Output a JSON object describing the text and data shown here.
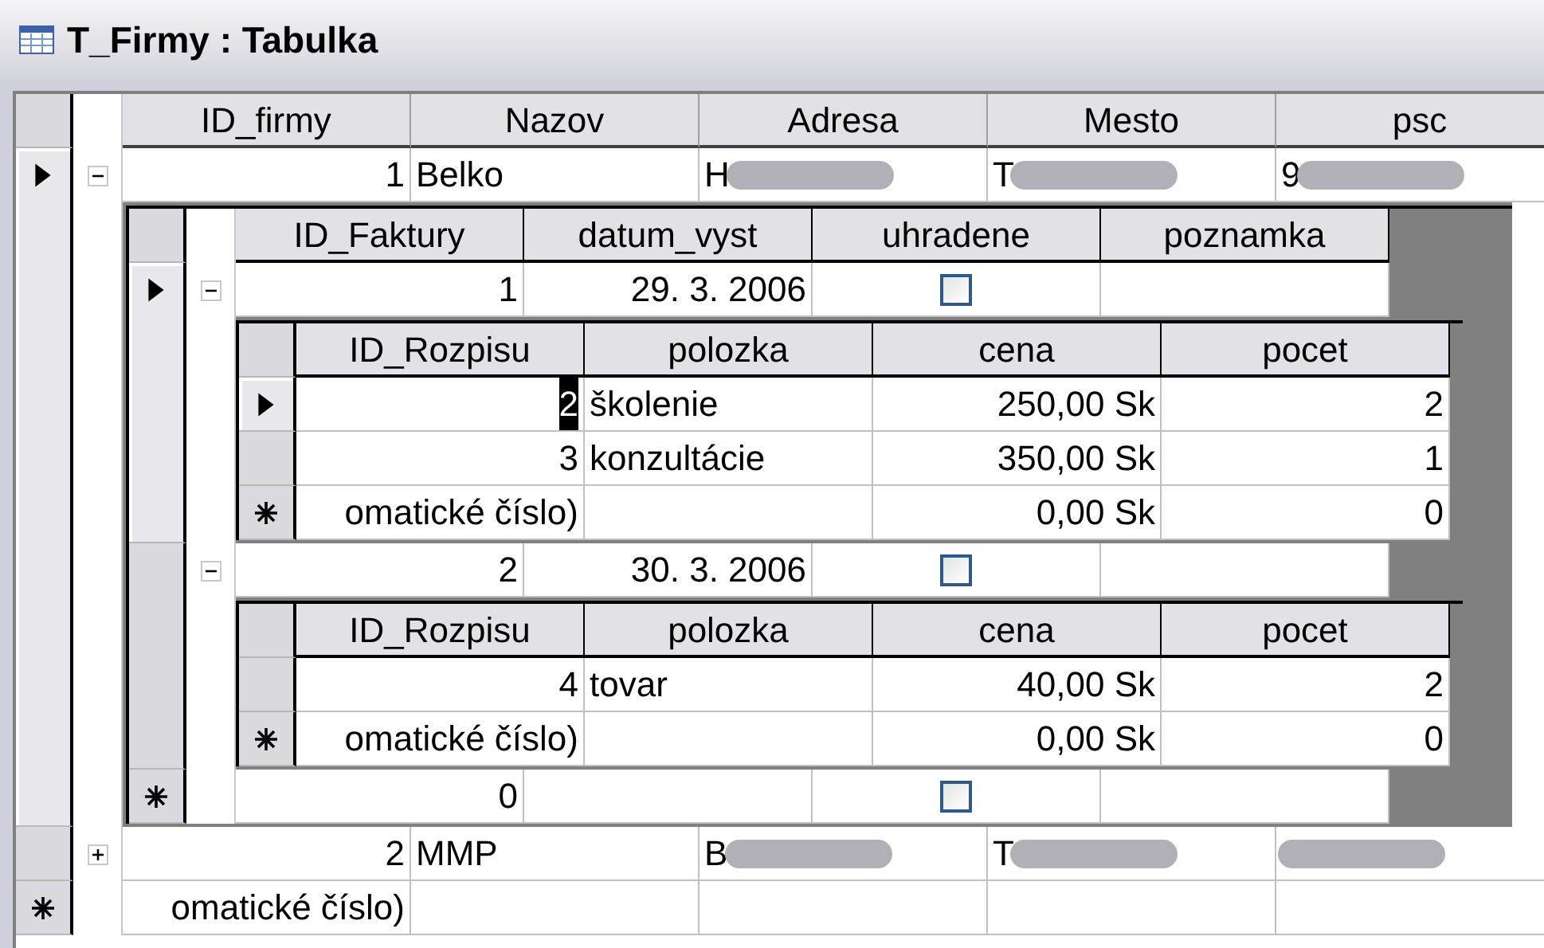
{
  "window": {
    "title": "T_Firmy : Tabulka"
  },
  "table": {
    "columns": [
      {
        "label": "ID_firmy",
        "kind": "number"
      },
      {
        "label": "Nazov",
        "kind": "text"
      },
      {
        "label": "Adresa",
        "kind": "text"
      },
      {
        "label": "Mesto",
        "kind": "text"
      },
      {
        "label": "psc",
        "kind": "text"
      }
    ],
    "rows": [
      {
        "selected": true,
        "expanded": true,
        "cells": [
          {
            "text": "1"
          },
          {
            "text": "Belko"
          },
          {
            "text": "H",
            "redacted": true
          },
          {
            "text": "T",
            "redacted": true
          },
          {
            "text": "9",
            "redacted": true
          }
        ],
        "subtable": {
          "columns": [
            {
              "label": "ID_Faktury",
              "kind": "number"
            },
            {
              "label": "datum_vyst",
              "kind": "number"
            },
            {
              "label": "uhradene",
              "kind": "checkbox"
            },
            {
              "label": "poznamka",
              "kind": "text"
            }
          ],
          "rows": [
            {
              "selected": true,
              "expanded": true,
              "cells": [
                {
                  "text": "1"
                },
                {
                  "text": "29. 3. 2006"
                },
                {
                  "checked": false
                },
                {}
              ],
              "subtable": {
                "columns": [
                  {
                    "label": "ID_Rozpisu",
                    "kind": "number"
                  },
                  {
                    "label": "polozka",
                    "kind": "text"
                  },
                  {
                    "label": "cena",
                    "kind": "number"
                  },
                  {
                    "label": "pocet",
                    "kind": "number"
                  }
                ],
                "rows": [
                  {
                    "selected": true,
                    "cells": [
                      {
                        "text": "2",
                        "focused": true
                      },
                      {
                        "text": "školenie"
                      },
                      {
                        "text": "250,00 Sk"
                      },
                      {
                        "text": "2"
                      }
                    ]
                  },
                  {
                    "selected": false,
                    "cells": [
                      {
                        "text": "3"
                      },
                      {
                        "text": "konzultácie"
                      },
                      {
                        "text": "350,00 Sk"
                      },
                      {
                        "text": "1"
                      }
                    ]
                  }
                ],
                "new_row": {
                  "cells": [
                    {
                      "text": "omatické číslo)"
                    },
                    {},
                    {
                      "text": "0,00 Sk"
                    },
                    {
                      "text": "0"
                    }
                  ]
                }
              }
            },
            {
              "selected": false,
              "expanded": true,
              "cells": [
                {
                  "text": "2"
                },
                {
                  "text": "30. 3. 2006"
                },
                {
                  "checked": false
                },
                {}
              ],
              "subtable": {
                "columns": [
                  {
                    "label": "ID_Rozpisu",
                    "kind": "number"
                  },
                  {
                    "label": "polozka",
                    "kind": "text"
                  },
                  {
                    "label": "cena",
                    "kind": "number"
                  },
                  {
                    "label": "pocet",
                    "kind": "number"
                  }
                ],
                "rows": [
                  {
                    "selected": false,
                    "cells": [
                      {
                        "text": "4"
                      },
                      {
                        "text": "tovar"
                      },
                      {
                        "text": "40,00 Sk"
                      },
                      {
                        "text": "2"
                      }
                    ]
                  }
                ],
                "new_row": {
                  "cells": [
                    {
                      "text": "omatické číslo)"
                    },
                    {},
                    {
                      "text": "0,00 Sk"
                    },
                    {
                      "text": "0"
                    }
                  ]
                }
              }
            }
          ],
          "new_row": {
            "cells": [
              {
                "text": "0"
              },
              {},
              {
                "checked": false
              },
              {}
            ]
          }
        }
      },
      {
        "selected": false,
        "expanded": false,
        "cells": [
          {
            "text": "2"
          },
          {
            "text": "MMP"
          },
          {
            "text": "B",
            "redacted": true
          },
          {
            "text": "T",
            "redacted": true
          },
          {
            "redacted": true
          }
        ]
      }
    ],
    "new_row": {
      "cells": [
        {
          "text": "omatické číslo)"
        },
        {},
        {},
        {},
        {}
      ]
    }
  }
}
